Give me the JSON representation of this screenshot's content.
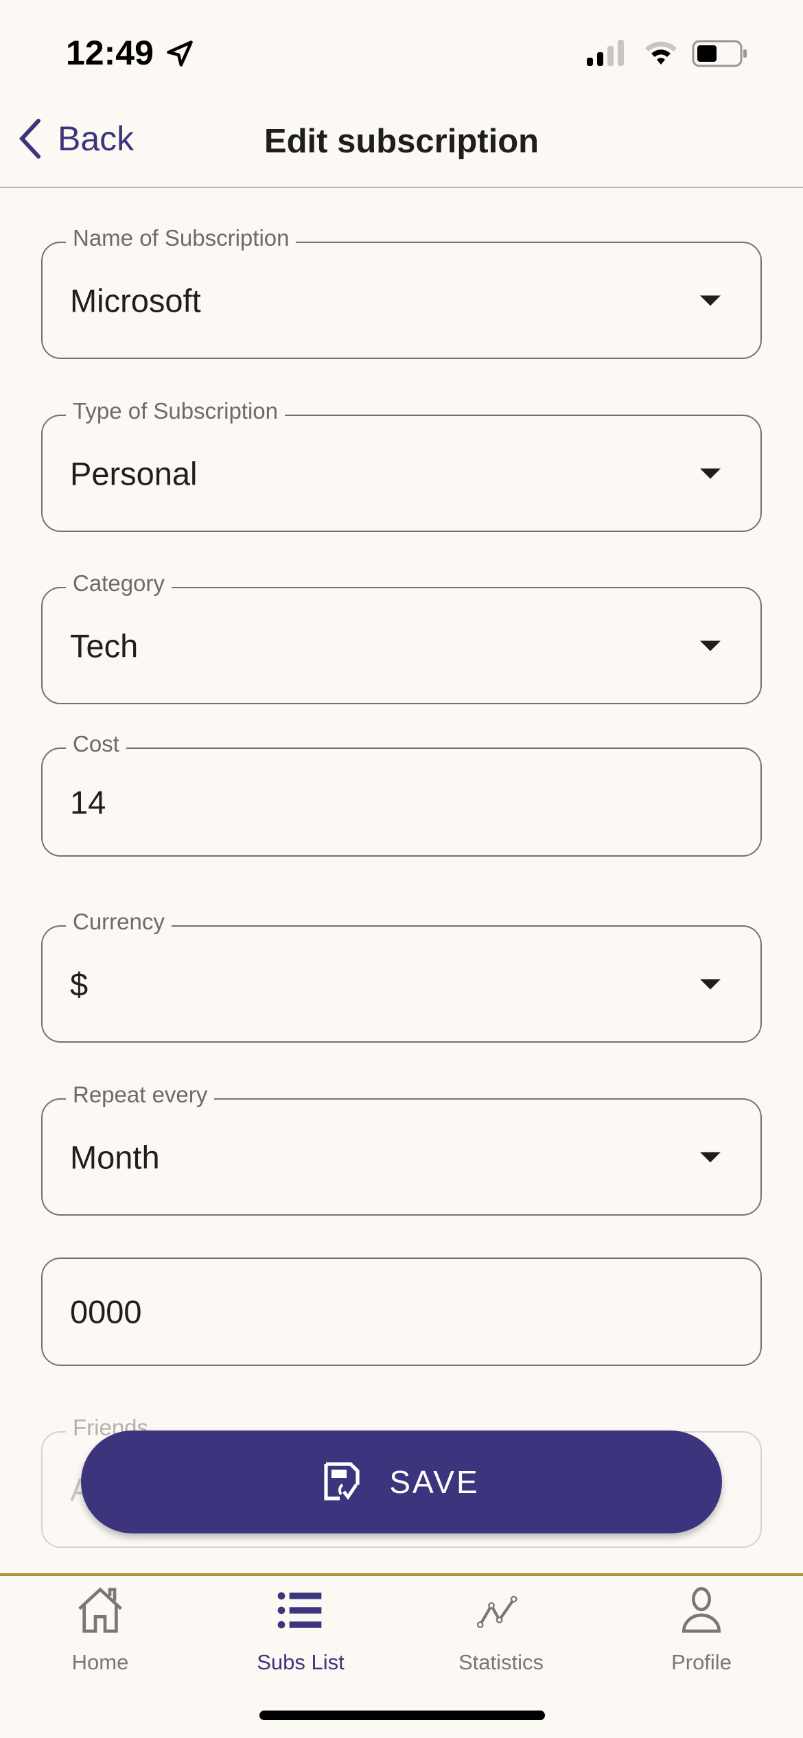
{
  "status_bar": {
    "time": "12:49"
  },
  "nav": {
    "back_label": "Back",
    "title": "Edit subscription"
  },
  "form": {
    "name": {
      "label": "Name of Subscription",
      "value": "Microsoft"
    },
    "type": {
      "label": "Type of Subscription",
      "value": "Personal"
    },
    "category": {
      "label": "Category",
      "value": "Tech"
    },
    "cost": {
      "label": "Cost",
      "value": "14"
    },
    "currency": {
      "label": "Currency",
      "value": "$"
    },
    "repeat": {
      "label": "Repeat every",
      "value": "Month"
    },
    "date": {
      "value": "0000"
    },
    "friends": {
      "label": "Friends",
      "placeholder": "A"
    }
  },
  "save_label": "SAVE",
  "tabs": [
    {
      "label": "Home"
    },
    {
      "label": "Subs List"
    },
    {
      "label": "Statistics"
    },
    {
      "label": "Profile"
    }
  ],
  "colors": {
    "accent": "#3c347c",
    "tab_border": "#b09530",
    "background": "#fcf9f5"
  }
}
